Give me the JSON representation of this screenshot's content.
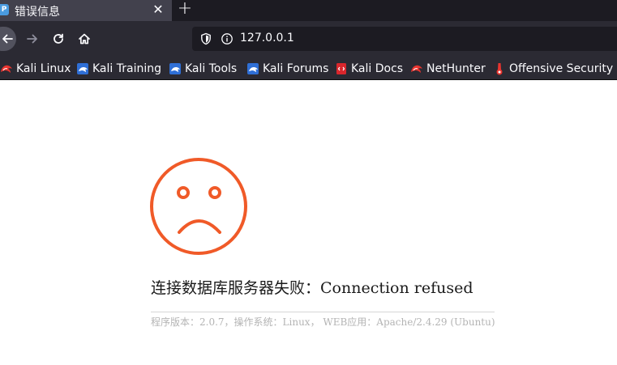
{
  "tab": {
    "favicon_letter": "P",
    "title": "错误信息",
    "close_glyph": "✕",
    "new_tab_glyph": "+"
  },
  "navbar": {
    "url": "127.0.0.1"
  },
  "bookmarks": [
    {
      "label": "Kali Linux",
      "icon": "kali-dragon-icon"
    },
    {
      "label": "Kali Training",
      "icon": "kali-training-icon"
    },
    {
      "label": "Kali Tools",
      "icon": "kali-tools-icon"
    },
    {
      "label": "Kali Forums",
      "icon": "kali-forums-icon"
    },
    {
      "label": "Kali Docs",
      "icon": "kali-docs-icon"
    },
    {
      "label": "NetHunter",
      "icon": "nethunter-icon"
    },
    {
      "label": "Offensive Security",
      "icon": "offensive-security-icon"
    }
  ],
  "page": {
    "error_message": "连接数据库服务器失败：Connection refused",
    "version_info": "程序版本：2.0.7，操作系统：Linux， WEB应用：Apache/2.4.29 (Ubuntu)"
  },
  "colors": {
    "accent": "#f05a28",
    "chrome_bg": "#2b2a33",
    "tabstrip_bg": "#1c1b22",
    "active_tab": "#42414d",
    "urlbar_bg": "#1c1b22"
  }
}
